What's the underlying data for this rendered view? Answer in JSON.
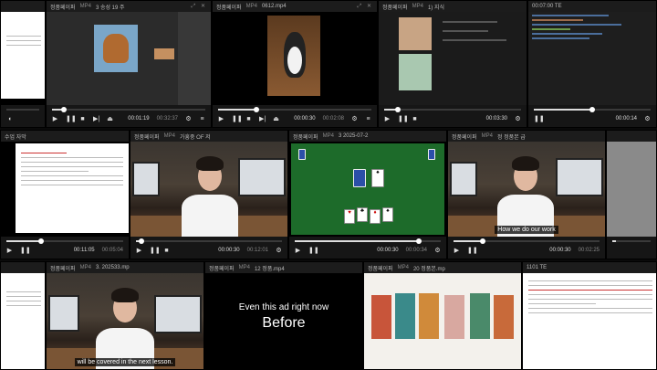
{
  "colors": {
    "background": "#0a0a0a",
    "titlebar": "#1c1c1c",
    "controls": "#161616",
    "seek_fill": "#dddddd"
  },
  "tiles": [
    {
      "title": "",
      "format": "",
      "time": "",
      "duration": "",
      "progress": 0.0,
      "subtitle": ""
    },
    {
      "title": "정품페이퍼",
      "format": "MP4",
      "title2": "3 송성 19 주",
      "time": "00:01:19",
      "duration": "00:32:37",
      "progress": 0.08,
      "subtitle": ""
    },
    {
      "title": "정품페이퍼",
      "format": "MP4",
      "title2": "0612.mp4",
      "time": "00:00:30",
      "duration": "00:02:08",
      "progress": 0.25,
      "subtitle": ""
    },
    {
      "title": "정품페이퍼",
      "format": "MP4",
      "title2": "1) 지식",
      "time": "00:03:30",
      "duration": "00:03:30",
      "progress": 0.1,
      "subtitle": ""
    },
    {
      "title": "",
      "format": "",
      "title2": "00:07:00 TE",
      "time": "00:00:14",
      "duration": "00:00:14",
      "progress": 0.5,
      "subtitle": ""
    },
    {
      "title": "",
      "format": "",
      "title2": "수업 자막",
      "time": "00:11:05",
      "duration": "00:05:04",
      "progress": 0.3,
      "subtitle": ""
    },
    {
      "title": "정품페이퍼",
      "format": "MP4",
      "title2": "가흥중 OF 저",
      "time": "00:00:30",
      "duration": "00:12:01",
      "progress": 0.04,
      "subtitle": ""
    },
    {
      "title": "정품페이퍼",
      "format": "MP4",
      "title2": "3 2025-07-2",
      "time": "00:00:30",
      "duration": "00:00:34",
      "progress": 0.85,
      "subtitle": ""
    },
    {
      "title": "정품페이퍼",
      "format": "MP4",
      "title2": "정 정품본 급",
      "time": "00:00:30",
      "duration": "00:02:25",
      "progress": 0.2,
      "subtitle": "How we do our work"
    },
    {
      "title": "",
      "format": "",
      "title2": "",
      "time": "",
      "duration": "",
      "progress": 0.1,
      "subtitle": ""
    },
    {
      "title": "정품페이퍼",
      "format": "MP4",
      "title2": "3. 202533.mp",
      "time": "",
      "duration": "",
      "progress": 0.0,
      "subtitle": "will be covered in the next lesson."
    },
    {
      "title": "정품페이퍼",
      "format": "MP4",
      "title2": "12 정품.mp4",
      "time": "",
      "duration": "",
      "progress": 0.0,
      "subtitle": "",
      "caption_small": "Even this ad right now",
      "caption_big": "Before"
    },
    {
      "title": "정품페이퍼",
      "format": "MP4",
      "title2": "20 정품본.mp",
      "time": "",
      "duration": "",
      "progress": 0.0,
      "subtitle": ""
    },
    {
      "title": "",
      "format": "",
      "title2": "1101 TE",
      "time": "",
      "duration": "",
      "progress": 0.0,
      "subtitle": ""
    }
  ]
}
